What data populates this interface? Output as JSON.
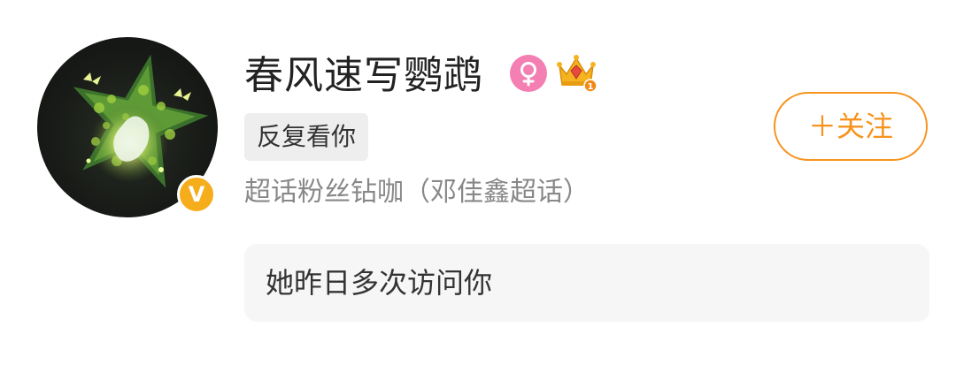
{
  "profile": {
    "username": "春风速写鹦鹉",
    "verified_badge_text": "V",
    "tag": "反复看你",
    "description": "超话粉丝钻咖（邓佳鑫超话）",
    "follow_label": "＋关注",
    "visit_notice": "她昨日多次访问你",
    "crown_level": "1"
  },
  "icons": {
    "avatar": "green-star-butterfly-avatar",
    "verified": "verified-v-badge-icon",
    "gender": "female-icon",
    "crown": "vip-crown-icon"
  },
  "colors": {
    "accent_orange": "#f7931e",
    "verified_yellow": "#f6ad1c",
    "gender_pink": "#f47fb3",
    "crown_gold": "#f5b31f",
    "crown_red": "#e8493f",
    "username_text": "#222222",
    "secondary_text": "#888888",
    "tag_background": "#eeeeee",
    "notice_background": "#f6f6f6"
  }
}
